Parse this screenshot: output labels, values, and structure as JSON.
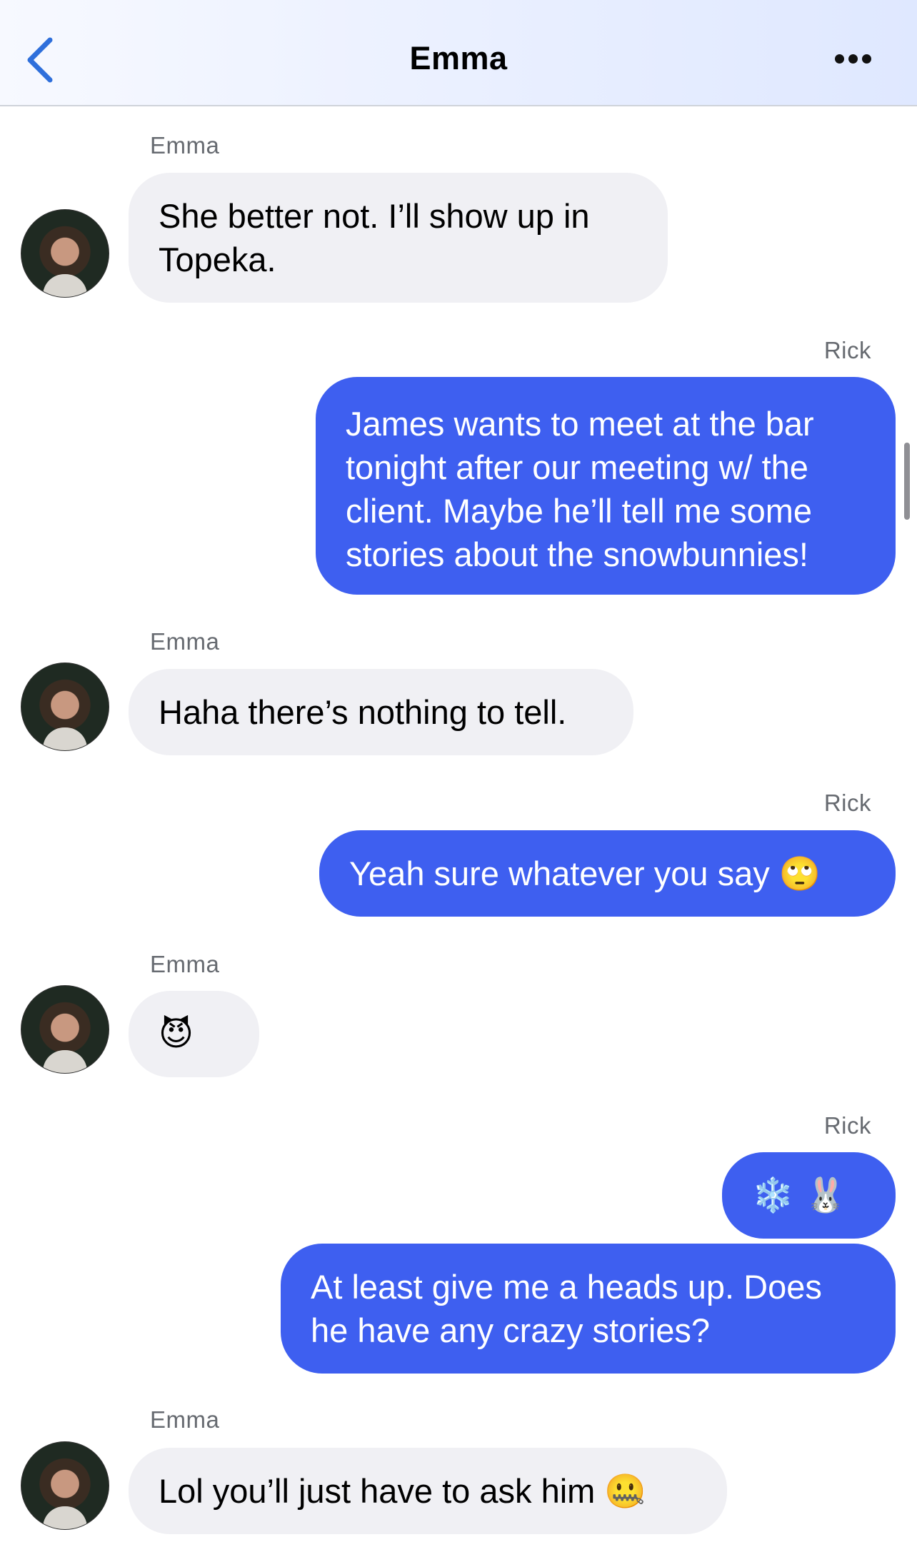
{
  "header": {
    "title": "Emma",
    "back_icon": "chevron-left-icon",
    "more_icon": "ellipsis-icon"
  },
  "colors": {
    "outgoing_bubble": "#3e5ff0",
    "incoming_bubble": "#f0f0f4",
    "back_accent": "#2f6fdb"
  },
  "messages": [
    {
      "sender": "Emma",
      "text": "She better not. I’ll show up in\nTopeka."
    },
    {
      "sender": "Rick",
      "text": "James wants to meet at the bar\ntonight after our meeting w/ the\nclient. Maybe he’ll tell me some\nstories about the snowbunnies!"
    },
    {
      "sender": "Emma",
      "text": "Haha there’s nothing to tell."
    },
    {
      "sender": "Rick",
      "text": "Yeah sure whatever you say 🙄"
    },
    {
      "sender": "Emma",
      "text": "😈"
    },
    {
      "sender": "Rick",
      "text": "❄️ 🐰"
    },
    {
      "sender": "Rick",
      "text": "At least give me a heads up. Does\nhe have any crazy stories?"
    },
    {
      "sender": "Emma",
      "text": "Lol you’ll just have to ask him 🤐"
    }
  ]
}
